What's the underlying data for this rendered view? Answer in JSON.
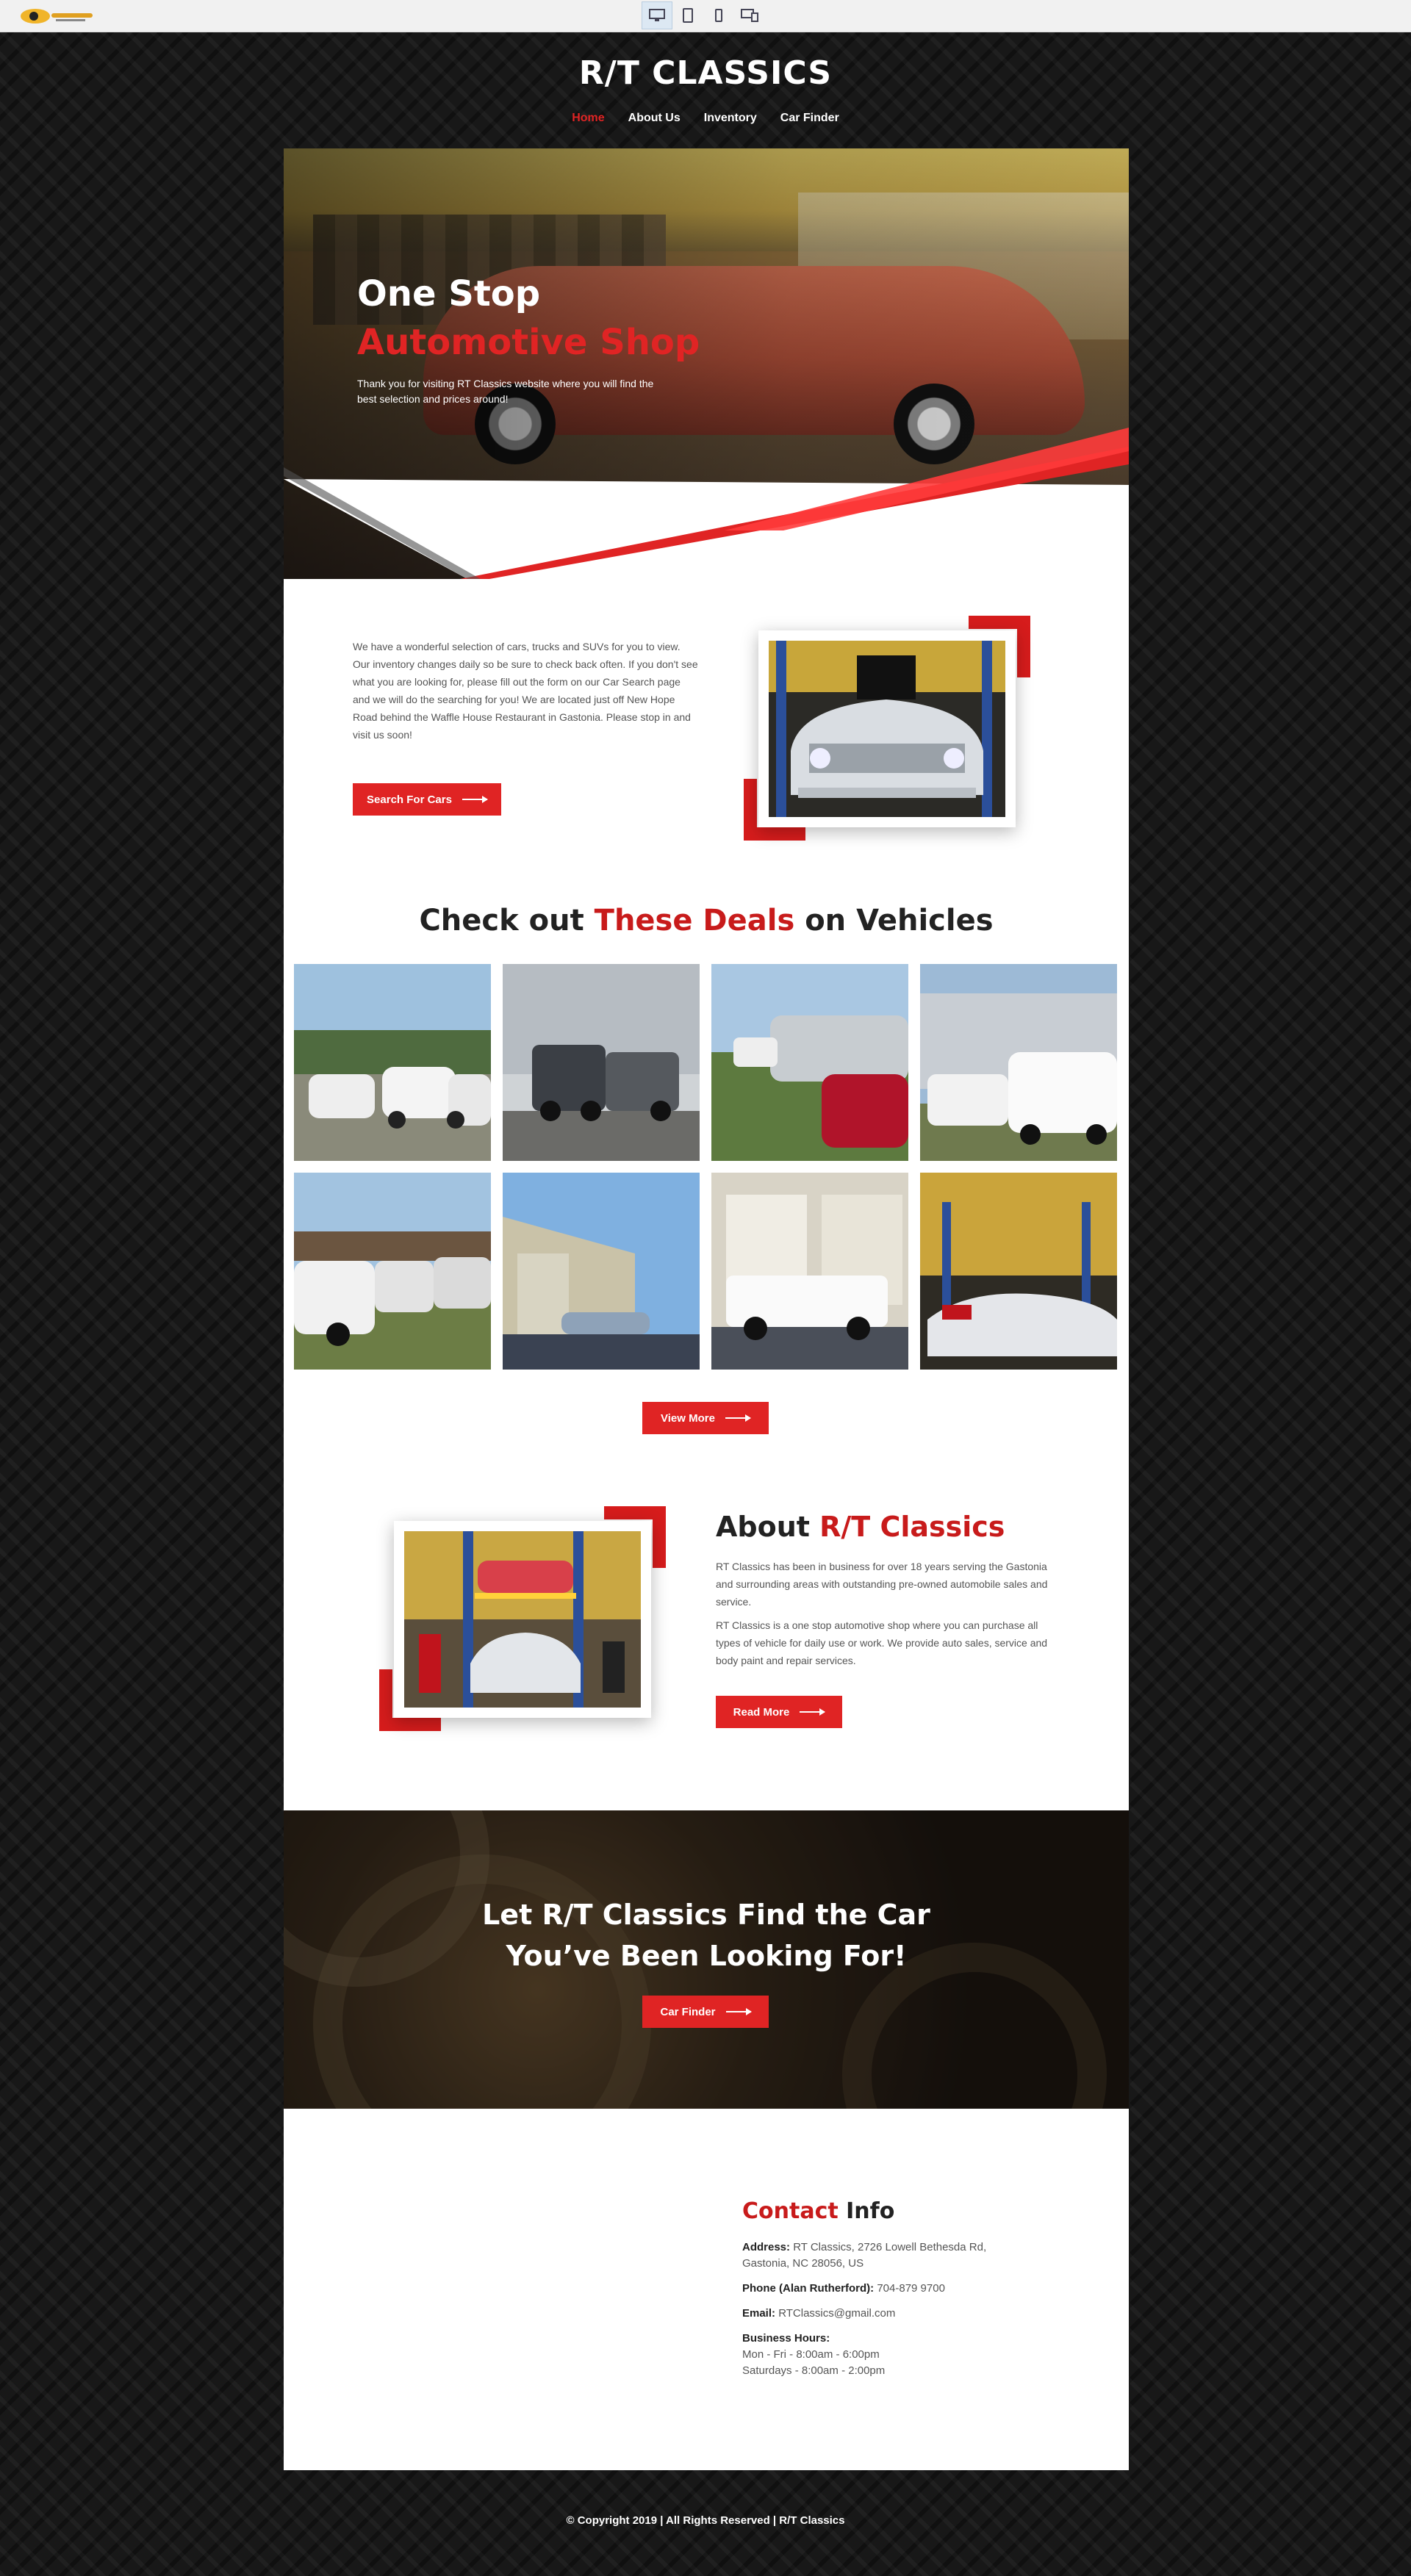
{
  "colors": {
    "accent": "#e02424",
    "dark_bg": "#181818",
    "text": "#555555"
  },
  "toolbar": {
    "logo_icon": "site-logo-thumbnail",
    "devices": [
      {
        "name": "desktop",
        "icon": "desktop-icon",
        "active": true
      },
      {
        "name": "tablet",
        "icon": "tablet-icon",
        "active": false
      },
      {
        "name": "phone",
        "icon": "phone-icon",
        "active": false
      },
      {
        "name": "multi",
        "icon": "multi-device-icon",
        "active": false
      }
    ]
  },
  "header": {
    "logo": "R/T CLASSICS",
    "nav": [
      {
        "label": "Home",
        "active": true
      },
      {
        "label": "About Us",
        "active": false
      },
      {
        "label": "Inventory",
        "active": false
      },
      {
        "label": "Car Finder",
        "active": false
      }
    ]
  },
  "hero": {
    "title_line1": "One Stop",
    "title_line2": "Automotive Shop",
    "subtitle": "Thank you for visiting RT Classics website where you will find the best selection and prices around!"
  },
  "intro": {
    "text": "We have a wonderful selection of cars, trucks and SUVs for you to view. Our inventory changes daily so be sure to check back often. If you don't see what you are looking for, please fill out the form on our Car Search page and we will do the searching for you! We are located just off New Hope Road behind the Waffle House Restaurant in Gastonia. Please stop in and visit us soon!",
    "button": "Search For Cars"
  },
  "deals": {
    "title_pre": "Check out ",
    "title_red": "These Deals",
    "title_post": " on Vehicles",
    "button": "View More"
  },
  "about": {
    "title_pre": "About ",
    "title_red": "R/T Classics",
    "p1": "RT Classics has been in business for over 18 years serving the Gastonia and surrounding areas with outstanding pre-owned automobile sales and service.",
    "p2": "RT Classics is a one stop automotive shop where you can purchase all types of vehicle for daily use or work. We provide auto sales, service and body paint and repair services.",
    "button": "Read More"
  },
  "cta": {
    "line1": "Let R/T Classics Find the Car",
    "line2": "You’ve Been Looking For!",
    "button": "Car Finder"
  },
  "contact": {
    "title_red": "Contact",
    "title_post": " Info",
    "address_label": "Address:",
    "address": "RT Classics, 2726 Lowell Bethesda Rd, Gastonia, NC 28056, US",
    "phone_label": "Phone (Alan Rutherford):",
    "phone": "704-879 9700",
    "email_label": "Email:",
    "email": "RTClassics@gmail.com",
    "hours_label": "Business Hours:",
    "hours_weekday": "Mon - Fri - 8:00am - 6:00pm",
    "hours_saturday": "Saturdays - 8:00am - 2:00pm"
  },
  "footer": {
    "copyright": "© Copyright 2019 | All Rights Reserved | R/T Classics"
  }
}
